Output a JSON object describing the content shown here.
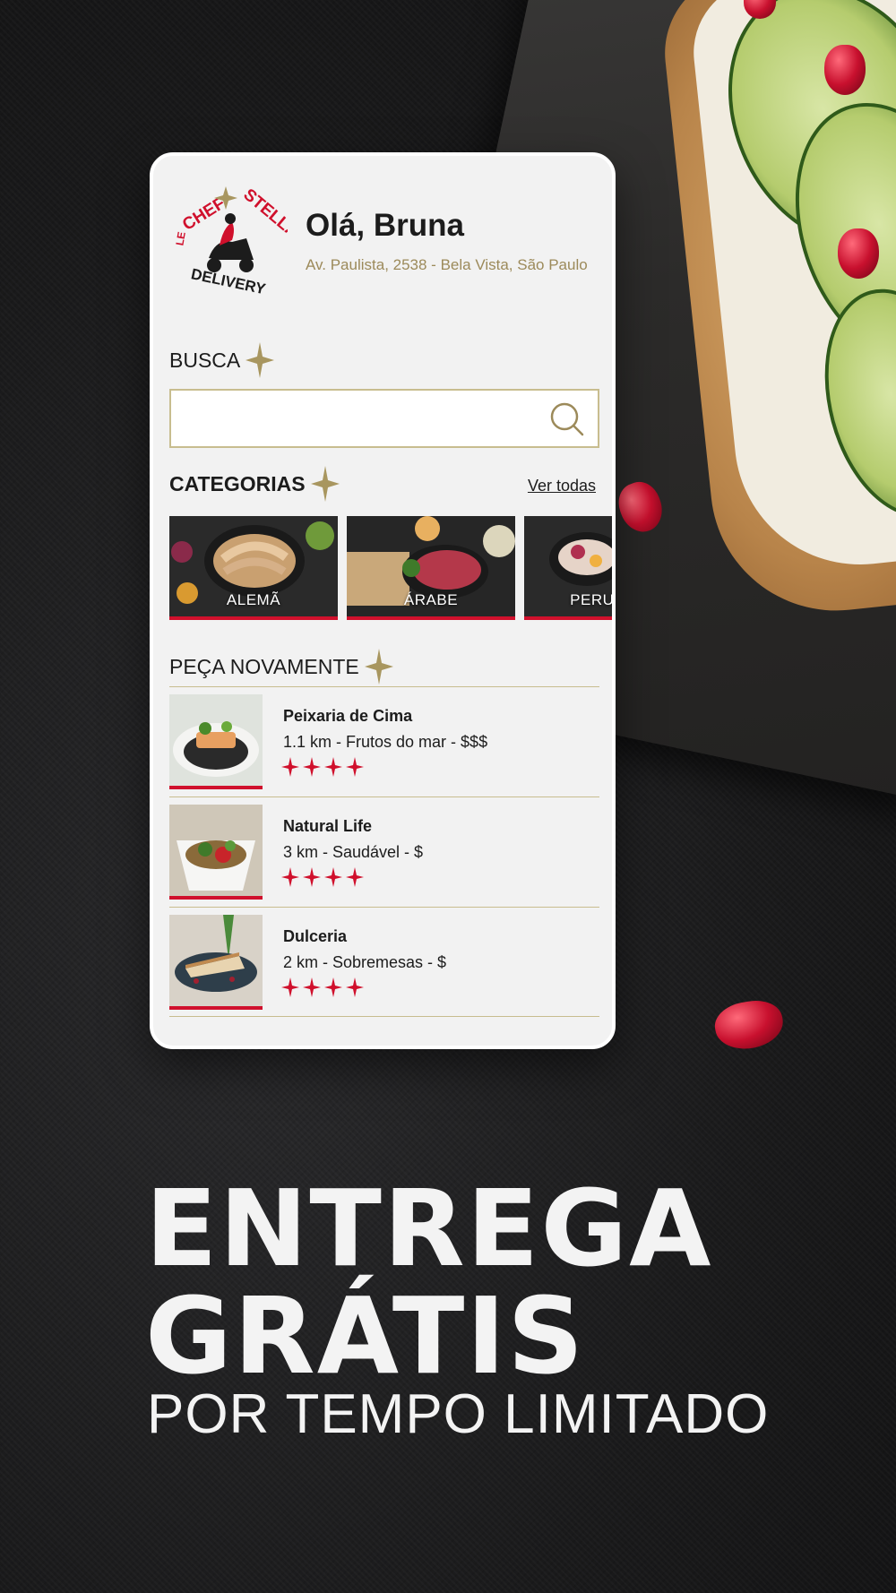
{
  "header": {
    "logo_top_left": "LE",
    "logo_chef": "CHEF",
    "logo_stella": "STELLA",
    "logo_bottom": "DELIVERY",
    "greeting": "Olá, Bruna",
    "address": "Av. Paulista, 2538 - Bela Vista, São Paulo"
  },
  "search": {
    "title": "BUSCA",
    "placeholder": ""
  },
  "categories": {
    "title": "CATEGORIAS",
    "see_all": "Ver todas",
    "items": [
      {
        "label": "ALEMÃ"
      },
      {
        "label": "ÁRABE"
      },
      {
        "label": "PERUANA"
      }
    ]
  },
  "order_again": {
    "title": "PEÇA NOVAMENTE",
    "items": [
      {
        "name": "Peixaria de Cima",
        "meta": "1.1 km - Frutos do mar - $$$",
        "rating": 4
      },
      {
        "name": "Natural Life",
        "meta": "3 km - Saudável - $",
        "rating": 4
      },
      {
        "name": "Dulceria",
        "meta": "2 km - Sobremesas - $",
        "rating": 4
      }
    ]
  },
  "promo": {
    "line1": "ENTREGA",
    "line2": "GRÁTIS",
    "line3": "POR TEMPO LIMITADO"
  },
  "colors": {
    "accent_red": "#d0102c",
    "gold": "#9c8a5a",
    "card_bg": "#f2f2f2"
  },
  "icons": [
    "sparkle-icon",
    "search-icon",
    "star-icon",
    "scooter-icon"
  ]
}
